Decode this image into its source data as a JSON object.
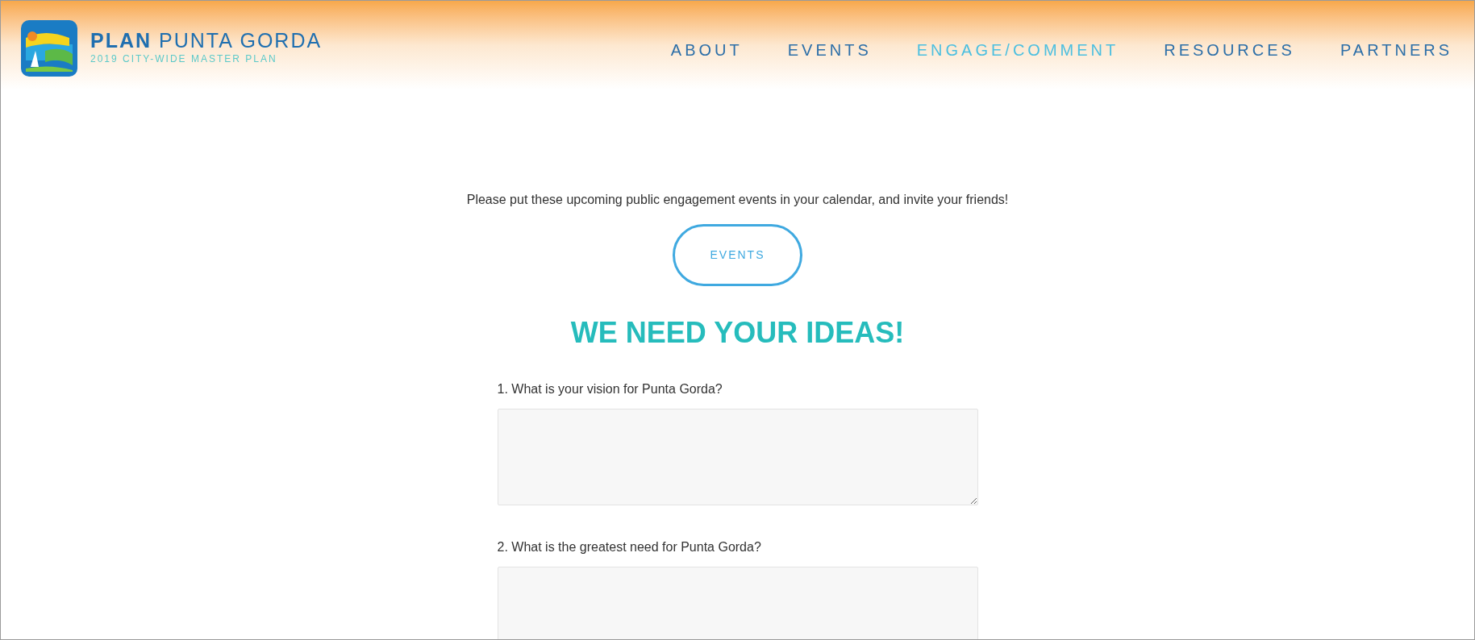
{
  "logo": {
    "title_bold": "PLAN",
    "title_rest": "PUNTA GORDA",
    "subtitle": "2019 CITY-WIDE MASTER PLAN"
  },
  "nav": [
    {
      "label": "ABOUT",
      "selected": false
    },
    {
      "label": "EVENTS",
      "selected": false
    },
    {
      "label": "ENGAGE/COMMENT",
      "selected": true
    },
    {
      "label": "RESOURCES",
      "selected": false
    },
    {
      "label": "PARTNERS",
      "selected": false
    }
  ],
  "intro": "Please put these upcoming public engagement events in your calendar, and invite your friends!",
  "events_button": "EVENTS",
  "heading": "WE NEED YOUR IDEAS!",
  "questions": [
    {
      "label": "1. What is your vision for Punta Gorda?"
    },
    {
      "label": "2. What is the greatest need for Punta Gorda?"
    }
  ]
}
